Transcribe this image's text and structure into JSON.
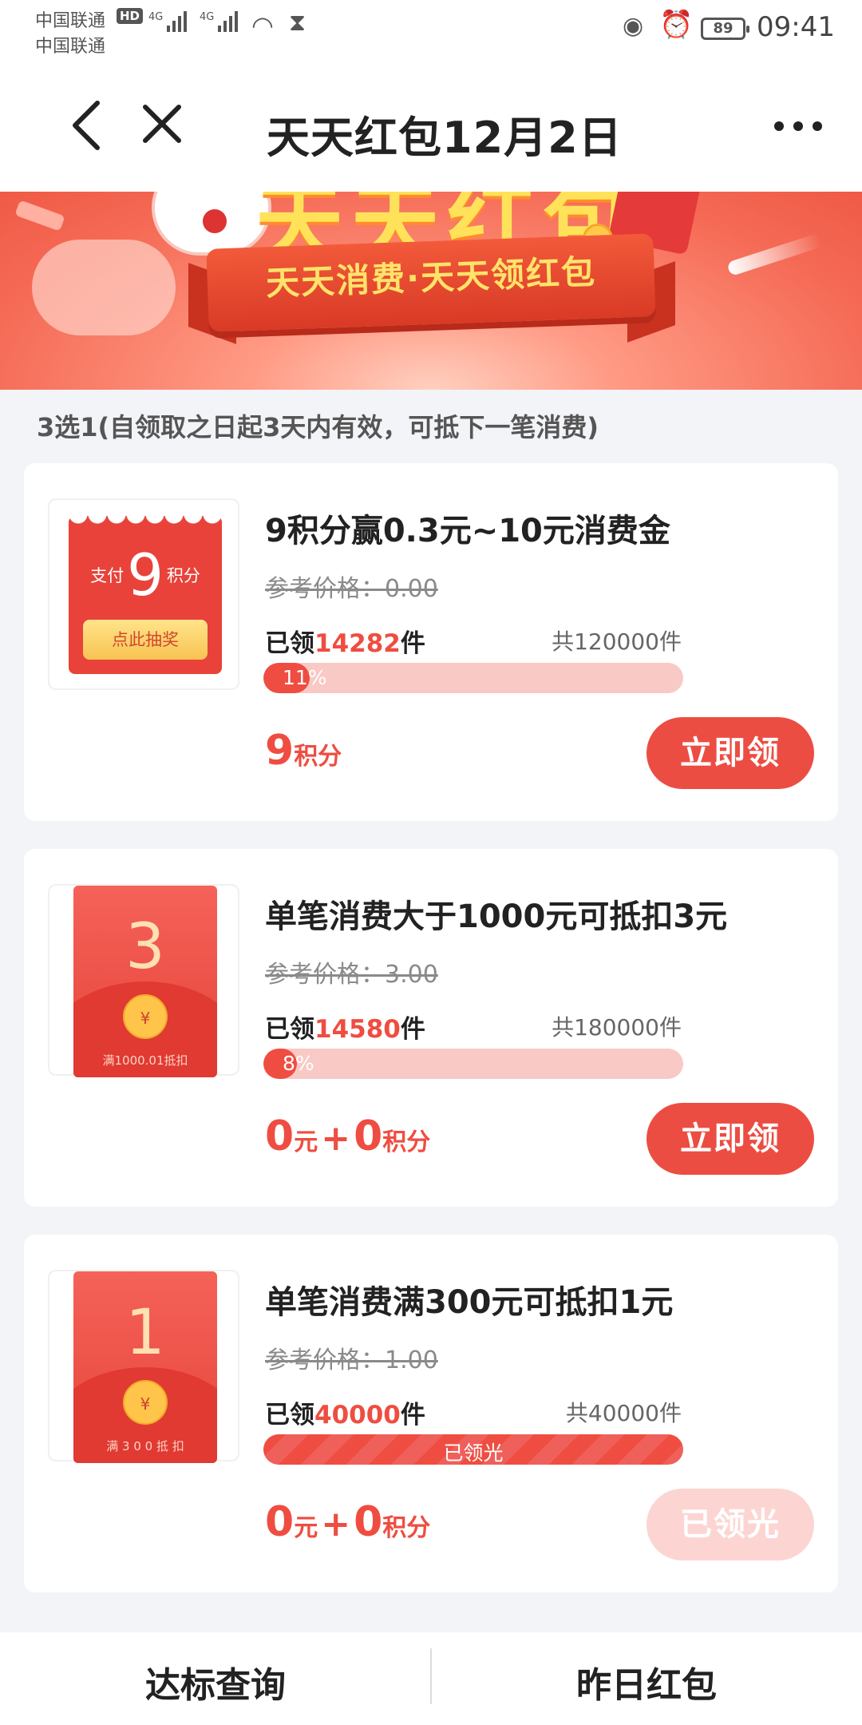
{
  "status_bar": {
    "carrier_1": "中国联通",
    "carrier_2": "中国联通",
    "hd": "HD",
    "signal_1": "4G",
    "signal_2": "4G",
    "battery": "89",
    "time": "09:41"
  },
  "header": {
    "title": "天天红包12月2日"
  },
  "banner": {
    "slogan": "天天消费·天天领红包"
  },
  "notice": "3选1(自领取之日起3天内有效，可抵下一笔消费)",
  "cards": [
    {
      "thumb": {
        "left": "支付",
        "amount": "9",
        "right": "积分",
        "button": "点此抽奖"
      },
      "title": "9积分赢0.3元~10元消费金",
      "ref_price": "参考价格：0.00",
      "claimed_prefix": "已领",
      "claimed_num": "14282",
      "claimed_suffix": "件",
      "total": "共120000件",
      "progress": 0.11,
      "progress_label": "11%",
      "price": {
        "num1": "9",
        "unit1": "积分"
      },
      "button": "立即领",
      "button_disabled": false
    },
    {
      "thumb": {
        "amount": "3",
        "seal": "¥",
        "cond": "满1000.01抵扣"
      },
      "title": "单笔消费大于1000元可抵扣3元",
      "ref_price": "参考价格：3.00",
      "claimed_prefix": "已领",
      "claimed_num": "14580",
      "claimed_suffix": "件",
      "total": "共180000件",
      "progress": 0.08,
      "progress_label": "8%",
      "price": {
        "num1": "0",
        "unit1": "元",
        "plus": "+",
        "num2": "0",
        "unit2": "积分"
      },
      "button": "立即领",
      "button_disabled": false
    },
    {
      "thumb": {
        "amount": "1",
        "seal": "¥",
        "cond": "满 3 0 0 抵 扣"
      },
      "title": "单笔消费满300元可抵扣1元",
      "ref_price": "参考价格：1.00",
      "claimed_prefix": "已领",
      "claimed_num": "40000",
      "claimed_suffix": "件",
      "total": "共40000件",
      "progress": 1.0,
      "progress_label": "已领光",
      "price": {
        "num1": "0",
        "unit1": "元",
        "plus": "+",
        "num2": "0",
        "unit2": "积分"
      },
      "button": "已领光",
      "button_disabled": true
    }
  ],
  "bottom_tabs": {
    "left": "达标查询",
    "right": "昨日红包"
  },
  "colors": {
    "accent": "#ec4d42",
    "progress_track": "#f9c9c6",
    "disabled_button": "#fcd5d2",
    "background": "#f3f4f8"
  }
}
